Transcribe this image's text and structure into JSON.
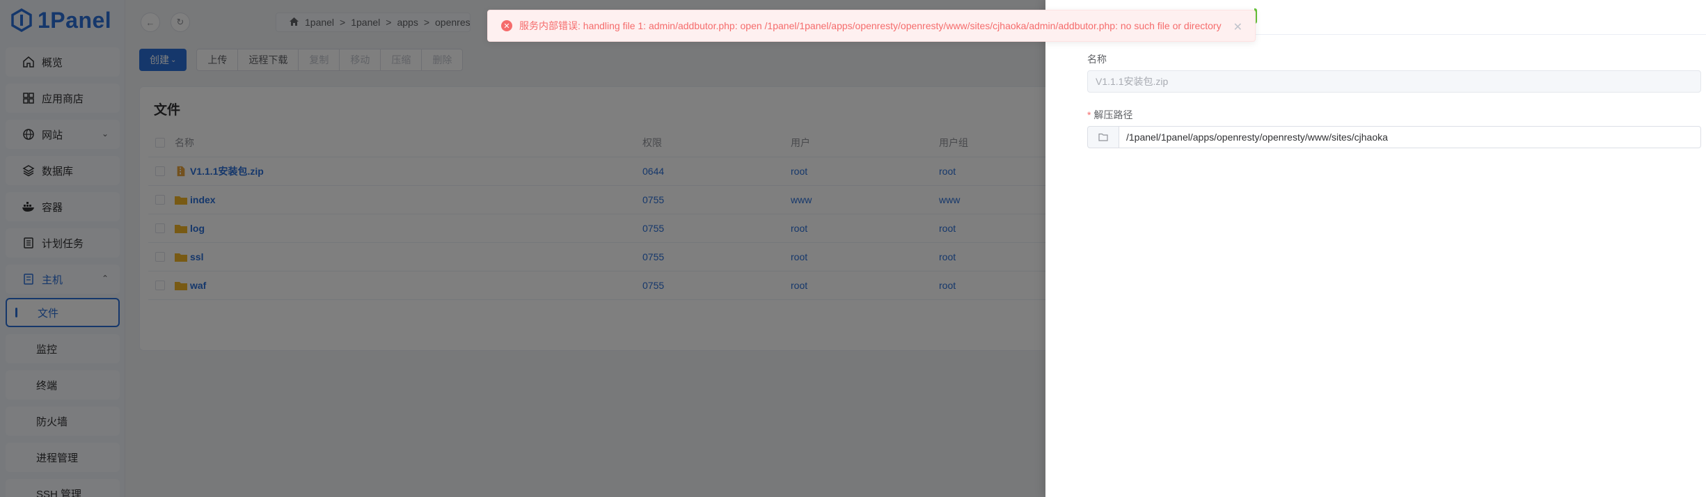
{
  "sidebar": {
    "logo_text": "1Panel",
    "items": [
      {
        "label": "概览",
        "icon": "home-icon"
      },
      {
        "label": "应用商店",
        "icon": "grid-icon"
      },
      {
        "label": "网站",
        "icon": "globe-icon"
      },
      {
        "label": "数据库",
        "icon": "layers-icon"
      },
      {
        "label": "容器",
        "icon": "docker-icon"
      },
      {
        "label": "计划任务",
        "icon": "task-icon"
      },
      {
        "label": "主机",
        "icon": "host-icon"
      }
    ],
    "submenu": [
      {
        "label": "文件"
      },
      {
        "label": "监控"
      },
      {
        "label": "终端"
      },
      {
        "label": "防火墙"
      },
      {
        "label": "进程管理"
      },
      {
        "label": "SSH 管理"
      }
    ]
  },
  "breadcrumb": {
    "parts": [
      "1panel",
      "1panel",
      "apps",
      "openresty",
      "o"
    ]
  },
  "toolbar": {
    "create": "创建",
    "upload": "上传",
    "remote_download": "远程下载",
    "copy": "复制",
    "move": "移动",
    "compress": "压缩",
    "delete": "删除"
  },
  "files": {
    "title": "文件",
    "columns": {
      "name": "名称",
      "perm": "权限",
      "user": "用户",
      "group": "用户组"
    },
    "rows": [
      {
        "name": "V1.1.1安装包.zip",
        "perm": "0644",
        "user": "root",
        "group": "root",
        "type": "zip"
      },
      {
        "name": "index",
        "perm": "0755",
        "user": "www",
        "group": "www",
        "type": "folder"
      },
      {
        "name": "log",
        "perm": "0755",
        "user": "root",
        "group": "root",
        "type": "folder"
      },
      {
        "name": "ssl",
        "perm": "0755",
        "user": "root",
        "group": "root",
        "type": "folder"
      },
      {
        "name": "waf",
        "perm": "0755",
        "user": "root",
        "group": "root",
        "type": "folder"
      }
    ]
  },
  "drawer": {
    "name_label": "名称",
    "name_value": "V1.1.1安装包.zip",
    "path_label": "解压路径",
    "path_value": "/1panel/1panel/apps/openresty/openresty/www/sites/cjhaoka"
  },
  "toast": {
    "message": "服务内部错误: handling file 1: admin/addbutor.php: open /1panel/1panel/apps/openresty/openresty/www/sites/cjhaoka/admin/addbutor.php: no such file or directory"
  },
  "colors": {
    "primary": "#2b6fd6",
    "error": "#f56c6c",
    "success": "#67c23a"
  }
}
